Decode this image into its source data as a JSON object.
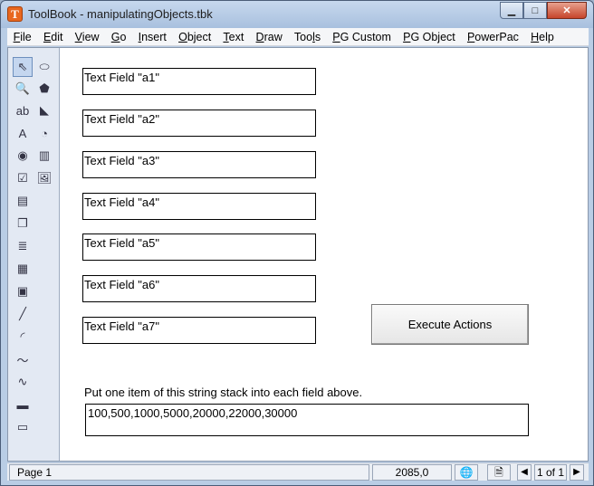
{
  "window": {
    "title": "ToolBook - manipulatingObjects.tbk",
    "app_icon_letter": "T",
    "minimize_glyph": "▁",
    "maximize_glyph": "□",
    "close_glyph": "✕"
  },
  "menu": [
    {
      "label": "File",
      "u": "F",
      "rest": "ile"
    },
    {
      "label": "Edit",
      "u": "E",
      "rest": "dit"
    },
    {
      "label": "View",
      "u": "V",
      "rest": "iew"
    },
    {
      "label": "Go",
      "u": "G",
      "rest": "o"
    },
    {
      "label": "Insert",
      "u": "I",
      "rest": "nsert"
    },
    {
      "label": "Object",
      "u": "O",
      "rest": "bject"
    },
    {
      "label": "Text",
      "u": "T",
      "rest": "ext"
    },
    {
      "label": "Draw",
      "u": "D",
      "rest": "raw"
    },
    {
      "label": "Tools",
      "pre": "Too",
      "u": "l",
      "rest": "s"
    },
    {
      "label": "PG Custom",
      "u": "P",
      "rest": "G Custom"
    },
    {
      "label": "PG Object",
      "u": "P",
      "rest": "G Object"
    },
    {
      "label": "PowerPac",
      "u": "P",
      "rest": "owerPac"
    },
    {
      "label": "Help",
      "u": "H",
      "rest": "elp"
    }
  ],
  "tools": [
    {
      "name": "pointer-tool-icon",
      "glyph": "⇖"
    },
    {
      "name": "ellipse-tool-icon",
      "glyph": "⬭"
    },
    {
      "name": "zoom-tool-icon",
      "glyph": "🔍"
    },
    {
      "name": "polygon-tool-icon",
      "glyph": "⬟"
    },
    {
      "name": "field-tool-icon",
      "glyph": "ab"
    },
    {
      "name": "pie-tool-icon",
      "glyph": "◣"
    },
    {
      "name": "text-tool-icon",
      "glyph": "A"
    },
    {
      "name": "arc-tool-icon",
      "glyph": "◔"
    },
    {
      "name": "radio-button-tool-icon",
      "glyph": "◉"
    },
    {
      "name": "video-tool-icon",
      "glyph": "▥"
    },
    {
      "name": "checkbox-tool-icon",
      "glyph": "☑"
    },
    {
      "name": "picture-tool-icon",
      "glyph": "🖼"
    },
    {
      "name": "listbox-tool-icon",
      "glyph": "▤"
    },
    {
      "name": "combobox-tool-icon",
      "glyph": "❐"
    },
    {
      "name": "paragraph-tool-icon",
      "glyph": "≣"
    },
    {
      "name": "hotword-tool-icon",
      "glyph": "▦"
    },
    {
      "name": "scrolling-field-tool-icon",
      "glyph": "▣"
    },
    {
      "name": "line-tool-icon",
      "glyph": "╱"
    },
    {
      "name": "curve-tool-icon",
      "glyph": "◜"
    },
    {
      "name": "polyline-tool-icon",
      "glyph": "〜"
    },
    {
      "name": "freehand-tool-icon",
      "glyph": "∿"
    },
    {
      "name": "rectangle-tool-icon",
      "glyph": "▬"
    },
    {
      "name": "rounded-rect-tool-icon",
      "glyph": "▭"
    }
  ],
  "fields": [
    "Text Field \"a1\"",
    "Text Field \"a2\"",
    "Text Field \"a3\"",
    "Text Field \"a4\"",
    "Text Field \"a5\"",
    "Text Field \"a6\"",
    "Text Field \"a7\""
  ],
  "execute_button": "Execute Actions",
  "instruction": "Put one item of this string stack into each field above.",
  "string_stack": "100,500,1000,5000,20000,22000,30000",
  "status": {
    "page": "Page 1",
    "coords": "2085,0",
    "page_count": "1 of 1",
    "globe_glyph": "🌐",
    "doc_glyph": "🗎",
    "prev_glyph": "◀",
    "next_glyph": "▶"
  },
  "colors": {
    "accent_title": "#b9cde5",
    "palette_bg": "#e3e9f3"
  }
}
